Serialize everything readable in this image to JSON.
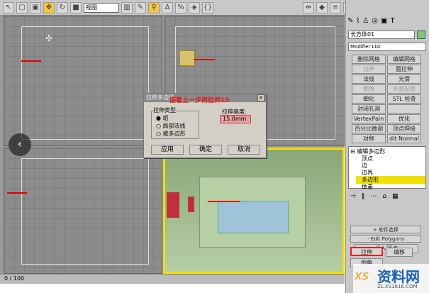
{
  "toolbar": {
    "view_select": "视图",
    "panel_view_select": "视图"
  },
  "dialog": {
    "title": "拉伸多边形",
    "annotation": "接着上一步再拉伸15",
    "group_label": "拉伸类型",
    "options": [
      {
        "label": "组",
        "checked": true
      },
      {
        "label": "局部法线",
        "checked": false
      },
      {
        "label": "按多边形",
        "checked": false
      }
    ],
    "height_label": "拉伸高度:",
    "height_value": "15.0mm",
    "apply": "应用",
    "ok": "确定",
    "cancel": "取消"
  },
  "panel": {
    "object_name": "长方体01",
    "modifier_list": "Modifier List",
    "buttons": [
      {
        "label": "删除网格",
        "enabled": true
      },
      {
        "label": "编辑网格",
        "enabled": true
      },
      {
        "label": "拉伸",
        "enabled": false
      },
      {
        "label": "面拉伸",
        "enabled": true
      },
      {
        "label": "法线",
        "enabled": true
      },
      {
        "label": "光滑",
        "enabled": true
      },
      {
        "label": "倒角",
        "enabled": false
      },
      {
        "label": "补面剖面",
        "enabled": false
      },
      {
        "label": "细化",
        "enabled": true
      },
      {
        "label": "STL 检查",
        "enabled": true
      },
      {
        "label": "封闭孔洞",
        "enabled": true
      },
      {
        "label": "",
        "enabled": true
      },
      {
        "label": "VertexPain",
        "enabled": true
      },
      {
        "label": "优化",
        "enabled": true
      },
      {
        "label": "百分比微调",
        "enabled": true
      },
      {
        "label": "顶点焊接",
        "enabled": true
      },
      {
        "label": "对称",
        "enabled": true
      },
      {
        "label": "dit Normal",
        "enabled": true
      }
    ],
    "stack": [
      {
        "label": "编辑多边形",
        "selected": false
      },
      {
        "label": "顶点",
        "selected": false
      },
      {
        "label": "边",
        "selected": false
      },
      {
        "label": "边界",
        "selected": false
      },
      {
        "label": "多边形",
        "selected": true
      },
      {
        "label": "体素",
        "selected": false
      }
    ],
    "rollout_soft": "软件选择",
    "rollout_edit": "Edit Polygons",
    "insert_vertex": "插入顶点",
    "extrude": "拉伸",
    "outline": "编移",
    "bevel": "倒角"
  },
  "timeline": {
    "frame": "0 / 100"
  },
  "watermark": {
    "text": "资料网",
    "url": "ZL.XS1616.COM"
  },
  "colors": {
    "highlight": "#f2e000",
    "annotation": "#e02020",
    "room": "#9fb88a"
  }
}
